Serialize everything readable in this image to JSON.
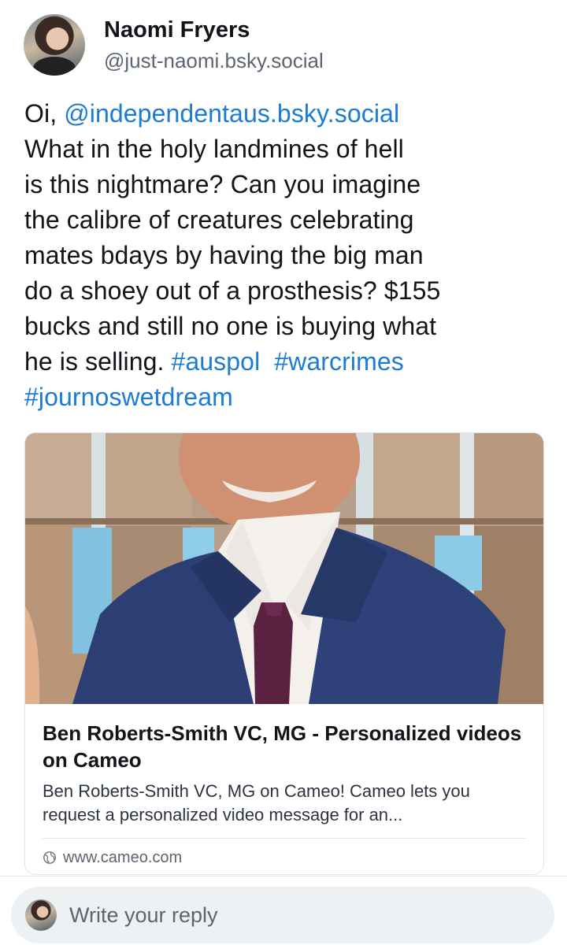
{
  "post": {
    "author": {
      "display_name": "Naomi Fryers",
      "handle": "@just-naomi.bsky.social"
    },
    "text": {
      "greeting": "Oi, ",
      "mention": "@independentaus.bsky.social",
      "line1": "What in the holy landmines of hell",
      "line2": "is this nightmare? Can you imagine",
      "line3": "the calibre of creatures celebrating",
      "line4": "mates bdays by having the big man",
      "line5": "do a shoey out of a prosthesis? $155",
      "line6": "bucks and still no one is buying what",
      "line7_prefix": "he is selling. ",
      "hashtag1": "#auspol",
      "hashtag2": "#warcrimes",
      "hashtag3": "#journoswetdream"
    },
    "link_card": {
      "title": "Ben Roberts-Smith VC, MG - Personalized videos on Cameo",
      "description": "Ben Roberts-Smith VC, MG on Cameo! Cameo lets you request a personalized video message for an...",
      "domain": "www.cameo.com",
      "domain_icon": "globe-icon"
    }
  },
  "composer": {
    "placeholder": "Write your reply"
  },
  "colors": {
    "link": "#1b7bd5",
    "text": "#111418",
    "muted": "#5b6571",
    "reply_bar_bg": "#eef1f4"
  }
}
